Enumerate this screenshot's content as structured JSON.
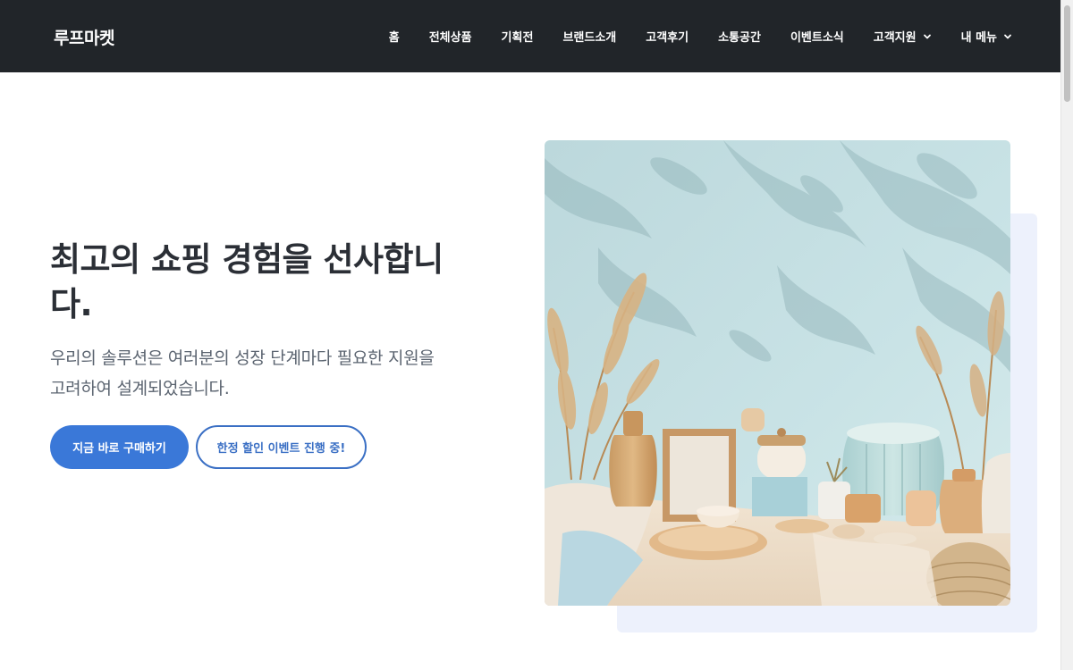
{
  "header": {
    "logo": "루프마켓",
    "nav": [
      {
        "label": "홈",
        "dropdown": false
      },
      {
        "label": "전체상품",
        "dropdown": false
      },
      {
        "label": "기획전",
        "dropdown": false
      },
      {
        "label": "브랜드소개",
        "dropdown": false
      },
      {
        "label": "고객후기",
        "dropdown": false
      },
      {
        "label": "소통공간",
        "dropdown": false
      },
      {
        "label": "이벤트소식",
        "dropdown": false
      },
      {
        "label": "고객지원",
        "dropdown": true
      },
      {
        "label": "내 메뉴",
        "dropdown": true
      }
    ]
  },
  "hero": {
    "title": "최고의 쇼핑 경험을 선사합니다.",
    "description": "우리의 솔루션은 여러분의 성장 단계마다 필요한 지원을 고려하여 설계되었습니다.",
    "primary_button": "지금 바로 구매하기",
    "secondary_button": "한정 할인 이벤트 진행 중!"
  },
  "colors": {
    "header_bg": "#212529",
    "primary": "#3a78d8",
    "outline": "#3a6fc4",
    "backdrop": "#edf1fc"
  }
}
